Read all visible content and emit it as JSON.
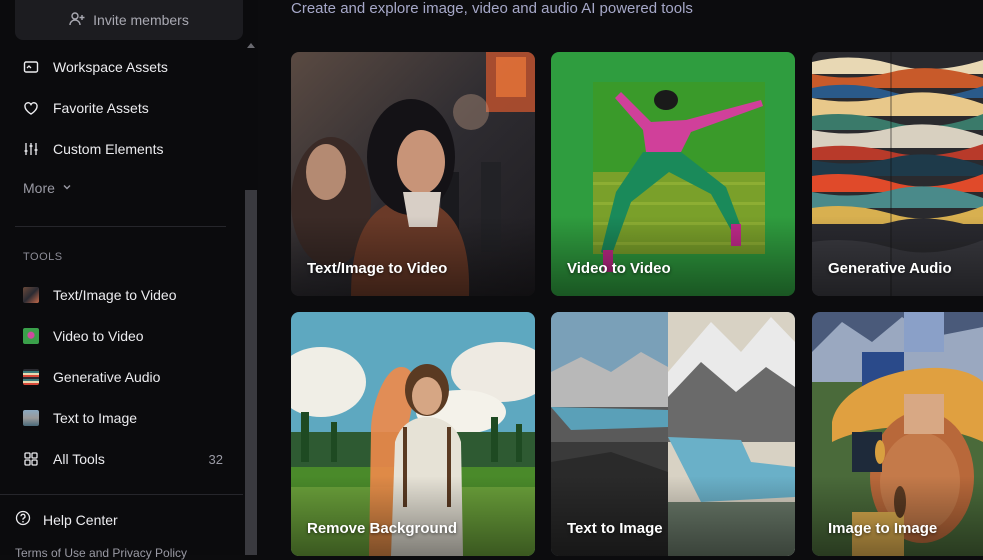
{
  "sidebar": {
    "invite_label": "Invite members",
    "items": [
      {
        "label": "Workspace Assets",
        "icon": "folder-image-icon"
      },
      {
        "label": "Favorite Assets",
        "icon": "heart-icon"
      },
      {
        "label": "Custom Elements",
        "icon": "sliders-icon"
      }
    ],
    "more_label": "More",
    "tools_heading": "TOOLS",
    "tools": [
      {
        "label": "Text/Image to Video"
      },
      {
        "label": "Video to Video"
      },
      {
        "label": "Generative Audio"
      },
      {
        "label": "Text to Image"
      },
      {
        "label": "All Tools",
        "count": "32"
      }
    ],
    "help_label": "Help Center",
    "footer_text": "Terms of Use and Privacy Policy"
  },
  "main": {
    "subtitle": "Create and explore image, video and audio AI powered tools",
    "cards": [
      {
        "label": "Text/Image to Video"
      },
      {
        "label": "Video to Video"
      },
      {
        "label": "Generative Audio"
      },
      {
        "label": "Remove Background"
      },
      {
        "label": "Text to Image"
      },
      {
        "label": "Image to Image"
      }
    ]
  },
  "colors": {
    "background": "#0c0c0e",
    "subtitle": "#a6a8c8",
    "green_screen": "#2e9e3e"
  }
}
